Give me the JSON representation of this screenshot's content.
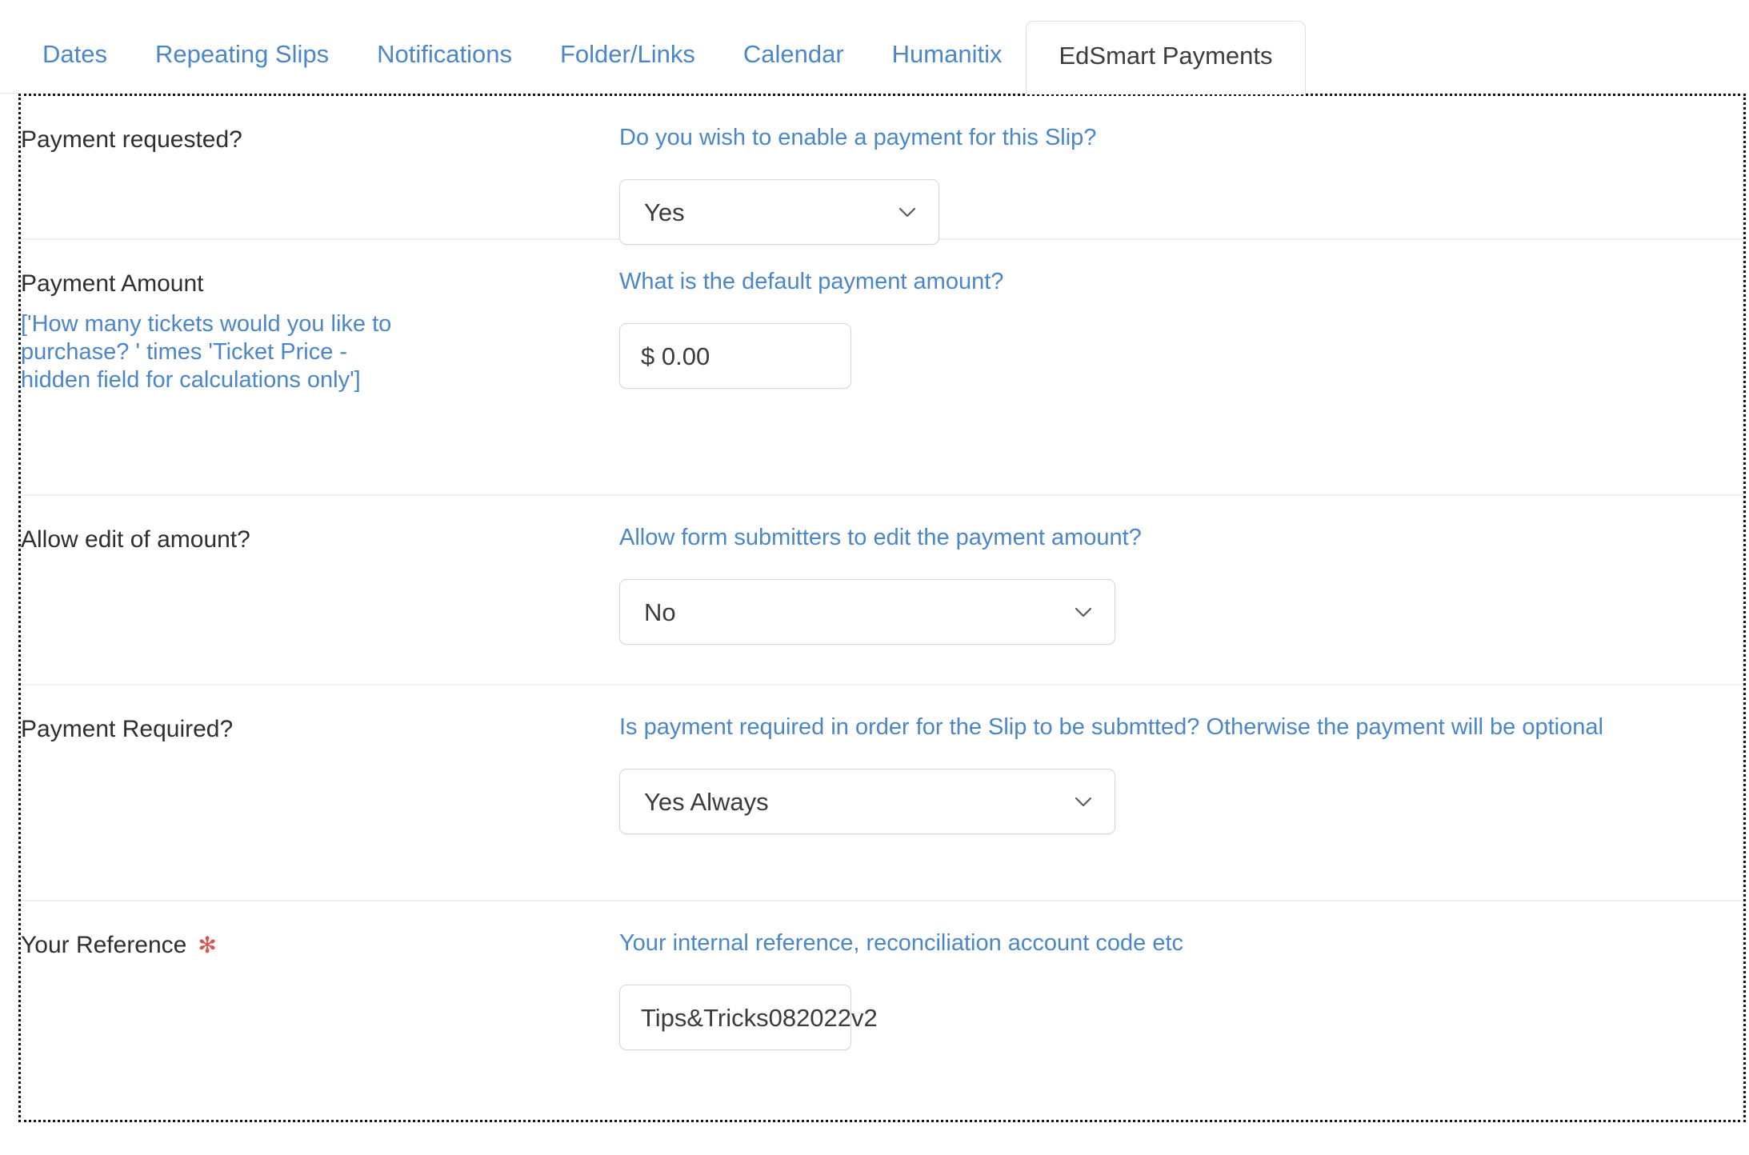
{
  "tabs": [
    {
      "label": "Dates",
      "active": false
    },
    {
      "label": "Repeating Slips",
      "active": false
    },
    {
      "label": "Notifications",
      "active": false
    },
    {
      "label": "Folder/Links",
      "active": false
    },
    {
      "label": "Calendar",
      "active": false
    },
    {
      "label": "Humanitix",
      "active": false
    },
    {
      "label": "EdSmart Payments",
      "active": true
    }
  ],
  "colors": {
    "link_blue": "#4a86c8",
    "label_dark": "#2e2e2e",
    "required_red": "#d9534f",
    "border_grey": "#d6d6d6",
    "row_divider": "#f0f0f0"
  },
  "rows": {
    "payment_requested": {
      "label": "Payment requested?",
      "help": "Do you wish to enable a payment for this Slip?",
      "select_value": "Yes",
      "chevron": "chevron-down-icon"
    },
    "payment_amount": {
      "label": "Payment Amount",
      "sublabel": "['How many tickets would you like to purchase? ' times 'Ticket Price - hidden field for calculations only']",
      "help": "What is the default payment amount?",
      "input_value": "$ 0.00"
    },
    "allow_edit": {
      "label": "Allow edit of amount?",
      "help": "Allow form submitters to edit the payment amount?",
      "select_value": "No",
      "chevron": "chevron-down-icon"
    },
    "payment_required": {
      "label": "Payment Required?",
      "help": "Is payment required in order for the Slip to be submtted? Otherwise the payment will be optional",
      "select_value": "Yes Always",
      "chevron": "chevron-down-icon"
    },
    "your_reference": {
      "label": "Your Reference",
      "required_marker": "✻",
      "help": "Your internal reference, reconciliation account code etc",
      "input_value": "Tips&Tricks082022v2"
    }
  }
}
